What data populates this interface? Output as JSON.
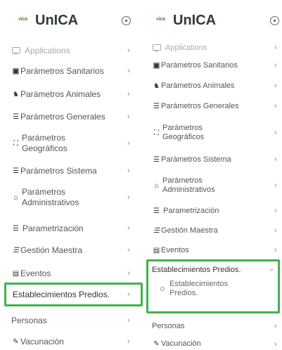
{
  "brand": {
    "logo_mark": "vica",
    "name": "UnICA"
  },
  "left_menu": [
    {
      "label": "Applications",
      "icon": "monitor-icon"
    },
    {
      "label": "Parámetros Sanitarios",
      "icon": "clipboard-icon"
    },
    {
      "label": "Parámetros Animales",
      "icon": "animals-icon"
    },
    {
      "label": "Parámetros Generales",
      "icon": "list-icon"
    },
    {
      "label": "Parámetros Geográficos",
      "icon": "map-icon"
    },
    {
      "label": "Parámetros Sistema",
      "icon": "list-icon"
    },
    {
      "label": "Parámetros Administrativos",
      "icon": "building-icon"
    },
    {
      "label": "Parametrización",
      "icon": "list-icon"
    },
    {
      "label": "Gestión Maestra",
      "icon": "italic-list-icon"
    },
    {
      "label": "Eventos",
      "icon": "calendar-icon"
    },
    {
      "label": "Establecimientos Predios.",
      "icon": ""
    },
    {
      "label": "Personas",
      "icon": ""
    },
    {
      "label": "Vacunación",
      "icon": "syringe-icon"
    }
  ],
  "right_menu": [
    {
      "label": "Applications",
      "icon": "monitor-icon"
    },
    {
      "label": "Parámetros Sanitarios",
      "icon": "clipboard-icon"
    },
    {
      "label": "Parámetros Animales",
      "icon": "animals-icon"
    },
    {
      "label": "Parámetros Generales",
      "icon": "list-icon"
    },
    {
      "label": "Parámetros Geográficos",
      "icon": "map-icon"
    },
    {
      "label": "Parámetros Sistema",
      "icon": "list-icon"
    },
    {
      "label": "Parámetros Administrativos",
      "icon": "building-icon"
    },
    {
      "label": "Parametrización",
      "icon": "list-icon"
    },
    {
      "label": "Gestión Maestra",
      "icon": "italic-list-icon"
    },
    {
      "label": "Eventos",
      "icon": "calendar-icon"
    },
    {
      "label": "Establecimientos Predios.",
      "icon": ""
    },
    {
      "label": "Establecimientos Predios.",
      "icon": ""
    },
    {
      "label": "Personas",
      "icon": ""
    },
    {
      "label": "Vacunación",
      "icon": "syringe-icon"
    }
  ],
  "colors": {
    "highlight": "#3cb54a",
    "logo": "#4a8a3a"
  }
}
